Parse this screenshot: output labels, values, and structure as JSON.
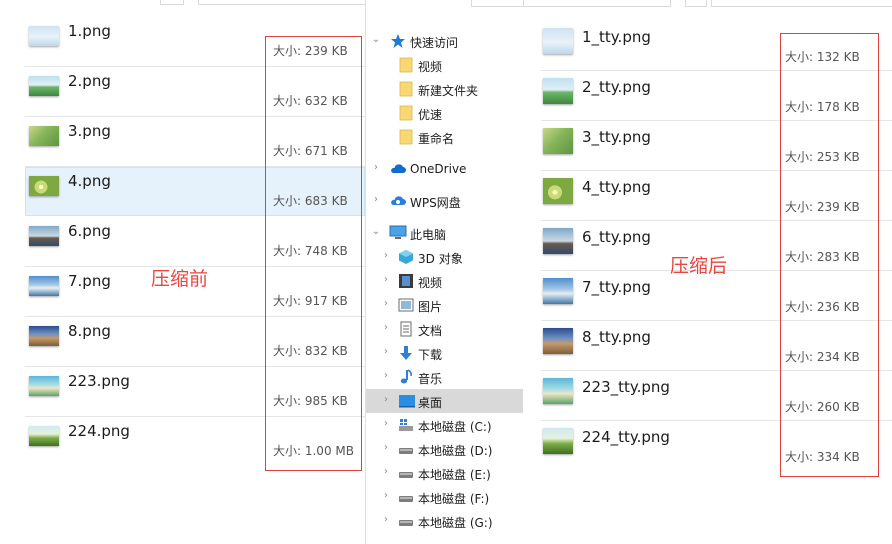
{
  "left": {
    "caption": "压缩前",
    "files": [
      {
        "name": "1.png",
        "size": "大小: 239 KB",
        "thumb": "sky-thumbnail"
      },
      {
        "name": "2.png",
        "size": "大小: 632 KB",
        "thumb": "field-thumbnail"
      },
      {
        "name": "3.png",
        "size": "大小: 671 KB",
        "thumb": "grass-thumbnail"
      },
      {
        "name": "4.png",
        "size": "大小: 683 KB",
        "thumb": "flower-thumbnail",
        "selected": true
      },
      {
        "name": "6.png",
        "size": "大小: 748 KB",
        "thumb": "coast-thumbnail"
      },
      {
        "name": "7.png",
        "size": "大小: 917 KB",
        "thumb": "lake-thumbnail"
      },
      {
        "name": "8.png",
        "size": "大小: 832 KB",
        "thumb": "city-thumbnail"
      },
      {
        "name": "223.png",
        "size": "大小: 985 KB",
        "thumb": "beach-thumbnail"
      },
      {
        "name": "224.png",
        "size": "大小: 1.00 MB",
        "thumb": "park-thumbnail"
      }
    ]
  },
  "nav": {
    "items": [
      {
        "label": "快速访问",
        "icon": "star-icon",
        "level": 0,
        "expanded": true
      },
      {
        "label": "视频",
        "icon": "folder-icon",
        "level": 1
      },
      {
        "label": "新建文件夹",
        "icon": "folder-icon",
        "level": 1
      },
      {
        "label": "优速",
        "icon": "folder-icon",
        "level": 1
      },
      {
        "label": "重命名",
        "icon": "folder-icon",
        "level": 1
      },
      {
        "label": "OneDrive",
        "icon": "cloud-icon",
        "level": 0
      },
      {
        "label": "WPS网盘",
        "icon": "wps-cloud-icon",
        "level": 0
      },
      {
        "label": "此电脑",
        "icon": "computer-icon",
        "level": 0,
        "expanded": true
      },
      {
        "label": "3D 对象",
        "icon": "cube-icon",
        "level": 1
      },
      {
        "label": "视频",
        "icon": "film-icon",
        "level": 1
      },
      {
        "label": "图片",
        "icon": "picture-icon",
        "level": 1
      },
      {
        "label": "文档",
        "icon": "document-icon",
        "level": 1
      },
      {
        "label": "下载",
        "icon": "download-icon",
        "level": 1
      },
      {
        "label": "音乐",
        "icon": "music-icon",
        "level": 1
      },
      {
        "label": "桌面",
        "icon": "desktop-icon",
        "level": 1,
        "active": true
      },
      {
        "label": "本地磁盘 (C:)",
        "icon": "windows-drive-icon",
        "level": 1
      },
      {
        "label": "本地磁盘 (D:)",
        "icon": "drive-icon",
        "level": 1
      },
      {
        "label": "本地磁盘 (E:)",
        "icon": "drive-icon",
        "level": 1
      },
      {
        "label": "本地磁盘 (F:)",
        "icon": "drive-icon",
        "level": 1
      },
      {
        "label": "本地磁盘 (G:)",
        "icon": "drive-icon",
        "level": 1
      }
    ]
  },
  "right": {
    "caption": "压缩后",
    "files": [
      {
        "name": "1_tty.png",
        "size": "大小: 132 KB",
        "thumb": "sky-thumbnail"
      },
      {
        "name": "2_tty.png",
        "size": "大小: 178 KB",
        "thumb": "field-thumbnail"
      },
      {
        "name": "3_tty.png",
        "size": "大小: 253 KB",
        "thumb": "grass-thumbnail"
      },
      {
        "name": "4_tty.png",
        "size": "大小: 239 KB",
        "thumb": "flower-thumbnail"
      },
      {
        "name": "6_tty.png",
        "size": "大小: 283 KB",
        "thumb": "coast-thumbnail"
      },
      {
        "name": "7_tty.png",
        "size": "大小: 236 KB",
        "thumb": "lake-thumbnail"
      },
      {
        "name": "8_tty.png",
        "size": "大小: 234 KB",
        "thumb": "city-thumbnail"
      },
      {
        "name": "223_tty.png",
        "size": "大小: 260 KB",
        "thumb": "beach-thumbnail"
      },
      {
        "name": "224_tty.png",
        "size": "大小: 334 KB",
        "thumb": "park-thumbnail"
      }
    ]
  },
  "colors": {
    "annotation_red": "#e0413a",
    "selection_bg": "#e5f1fb",
    "nav_active_bg": "#d9d9d9"
  }
}
